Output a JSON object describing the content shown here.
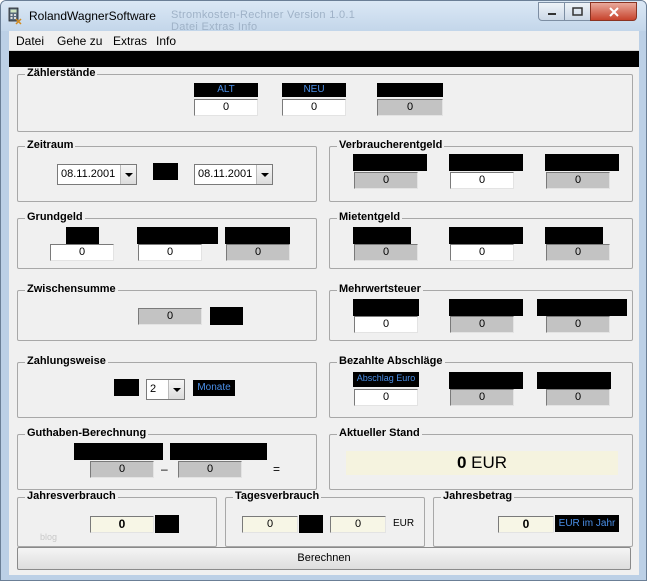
{
  "window": {
    "title": "RolandWagnerSoftware",
    "ghost_title": "Stromkosten-Rechner Version 1.0.1",
    "ghost_menu": "Datei  Extras  Info"
  },
  "menu": [
    "Datei",
    "Gehe zu",
    "Extras",
    "Info"
  ],
  "zaehlerstaende": {
    "title": "Zählerstände",
    "alt_label": "ALT",
    "neu_label": "NEU",
    "alt": "0",
    "neu": "0",
    "diff": "0"
  },
  "zeitraum": {
    "title": "Zeitraum",
    "von": "08.11.2001",
    "bis": "08.11.2001"
  },
  "verbraucherentgeld": {
    "title": "Verbraucherentgeld",
    "values": [
      "0",
      "0",
      "0"
    ]
  },
  "grundgeld": {
    "title": "Grundgeld",
    "values": [
      "0",
      "0",
      "0"
    ]
  },
  "mietentgeld": {
    "title": "Mietentgeld",
    "values": [
      "0",
      "0",
      "0"
    ]
  },
  "zwischensumme": {
    "title": "Zwischensumme",
    "value": "0"
  },
  "mehrwertsteuer": {
    "title": "Mehrwertsteuer",
    "values": [
      "0",
      "0",
      "0"
    ]
  },
  "zahlungsweise": {
    "title": "Zahlungsweise",
    "months": "2",
    "unit": "Monate"
  },
  "bezahlte_abschlaege": {
    "title": "Bezahlte Abschläge",
    "caption": "Abschlag Euro",
    "values": [
      "0",
      "0",
      "0"
    ]
  },
  "guthaben": {
    "title": "Guthaben-Berechnung",
    "a": "0",
    "b": "0",
    "minus": "–",
    "equals": "="
  },
  "aktueller_stand": {
    "title": "Aktueller Stand",
    "value": "0",
    "currency": "EUR"
  },
  "jahresverbrauch": {
    "title": "Jahresverbrauch",
    "value": "0",
    "watermark": "blog"
  },
  "tagesverbrauch": {
    "title": "Tagesverbrauch",
    "value1": "0",
    "value2": "0",
    "currency": "EUR"
  },
  "jahresbetrag": {
    "title": "Jahresbetrag",
    "value": "0",
    "unit": "EUR im Jahr"
  },
  "actions": {
    "calculate": "Berechnen"
  },
  "icons": {
    "app": "calculator-icon",
    "min": "minimize-icon",
    "max": "maximize-icon",
    "close": "close-icon"
  },
  "colors": {
    "caption_text": "#4a8fe8",
    "window_frame": "#bcd0e6",
    "close_button": "#c7432c"
  }
}
